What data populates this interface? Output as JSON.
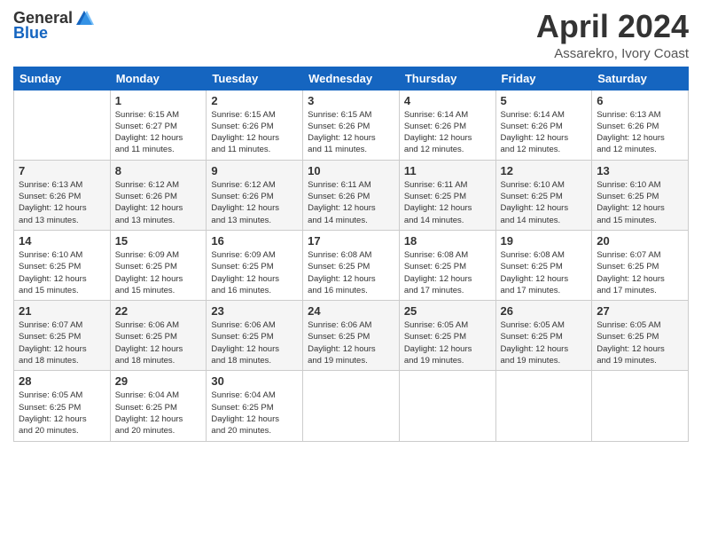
{
  "logo": {
    "text_general": "General",
    "text_blue": "Blue",
    "icon_shape": "triangle"
  },
  "header": {
    "month_title": "April 2024",
    "location": "Assarekro, Ivory Coast"
  },
  "days_of_week": [
    "Sunday",
    "Monday",
    "Tuesday",
    "Wednesday",
    "Thursday",
    "Friday",
    "Saturday"
  ],
  "weeks": [
    [
      {
        "day": "",
        "info": ""
      },
      {
        "day": "1",
        "info": "Sunrise: 6:15 AM\nSunset: 6:27 PM\nDaylight: 12 hours\nand 11 minutes."
      },
      {
        "day": "2",
        "info": "Sunrise: 6:15 AM\nSunset: 6:26 PM\nDaylight: 12 hours\nand 11 minutes."
      },
      {
        "day": "3",
        "info": "Sunrise: 6:15 AM\nSunset: 6:26 PM\nDaylight: 12 hours\nand 11 minutes."
      },
      {
        "day": "4",
        "info": "Sunrise: 6:14 AM\nSunset: 6:26 PM\nDaylight: 12 hours\nand 12 minutes."
      },
      {
        "day": "5",
        "info": "Sunrise: 6:14 AM\nSunset: 6:26 PM\nDaylight: 12 hours\nand 12 minutes."
      },
      {
        "day": "6",
        "info": "Sunrise: 6:13 AM\nSunset: 6:26 PM\nDaylight: 12 hours\nand 12 minutes."
      }
    ],
    [
      {
        "day": "7",
        "info": "Sunrise: 6:13 AM\nSunset: 6:26 PM\nDaylight: 12 hours\nand 13 minutes."
      },
      {
        "day": "8",
        "info": "Sunrise: 6:12 AM\nSunset: 6:26 PM\nDaylight: 12 hours\nand 13 minutes."
      },
      {
        "day": "9",
        "info": "Sunrise: 6:12 AM\nSunset: 6:26 PM\nDaylight: 12 hours\nand 13 minutes."
      },
      {
        "day": "10",
        "info": "Sunrise: 6:11 AM\nSunset: 6:26 PM\nDaylight: 12 hours\nand 14 minutes."
      },
      {
        "day": "11",
        "info": "Sunrise: 6:11 AM\nSunset: 6:25 PM\nDaylight: 12 hours\nand 14 minutes."
      },
      {
        "day": "12",
        "info": "Sunrise: 6:10 AM\nSunset: 6:25 PM\nDaylight: 12 hours\nand 14 minutes."
      },
      {
        "day": "13",
        "info": "Sunrise: 6:10 AM\nSunset: 6:25 PM\nDaylight: 12 hours\nand 15 minutes."
      }
    ],
    [
      {
        "day": "14",
        "info": "Sunrise: 6:10 AM\nSunset: 6:25 PM\nDaylight: 12 hours\nand 15 minutes."
      },
      {
        "day": "15",
        "info": "Sunrise: 6:09 AM\nSunset: 6:25 PM\nDaylight: 12 hours\nand 15 minutes."
      },
      {
        "day": "16",
        "info": "Sunrise: 6:09 AM\nSunset: 6:25 PM\nDaylight: 12 hours\nand 16 minutes."
      },
      {
        "day": "17",
        "info": "Sunrise: 6:08 AM\nSunset: 6:25 PM\nDaylight: 12 hours\nand 16 minutes."
      },
      {
        "day": "18",
        "info": "Sunrise: 6:08 AM\nSunset: 6:25 PM\nDaylight: 12 hours\nand 17 minutes."
      },
      {
        "day": "19",
        "info": "Sunrise: 6:08 AM\nSunset: 6:25 PM\nDaylight: 12 hours\nand 17 minutes."
      },
      {
        "day": "20",
        "info": "Sunrise: 6:07 AM\nSunset: 6:25 PM\nDaylight: 12 hours\nand 17 minutes."
      }
    ],
    [
      {
        "day": "21",
        "info": "Sunrise: 6:07 AM\nSunset: 6:25 PM\nDaylight: 12 hours\nand 18 minutes."
      },
      {
        "day": "22",
        "info": "Sunrise: 6:06 AM\nSunset: 6:25 PM\nDaylight: 12 hours\nand 18 minutes."
      },
      {
        "day": "23",
        "info": "Sunrise: 6:06 AM\nSunset: 6:25 PM\nDaylight: 12 hours\nand 18 minutes."
      },
      {
        "day": "24",
        "info": "Sunrise: 6:06 AM\nSunset: 6:25 PM\nDaylight: 12 hours\nand 19 minutes."
      },
      {
        "day": "25",
        "info": "Sunrise: 6:05 AM\nSunset: 6:25 PM\nDaylight: 12 hours\nand 19 minutes."
      },
      {
        "day": "26",
        "info": "Sunrise: 6:05 AM\nSunset: 6:25 PM\nDaylight: 12 hours\nand 19 minutes."
      },
      {
        "day": "27",
        "info": "Sunrise: 6:05 AM\nSunset: 6:25 PM\nDaylight: 12 hours\nand 19 minutes."
      }
    ],
    [
      {
        "day": "28",
        "info": "Sunrise: 6:05 AM\nSunset: 6:25 PM\nDaylight: 12 hours\nand 20 minutes."
      },
      {
        "day": "29",
        "info": "Sunrise: 6:04 AM\nSunset: 6:25 PM\nDaylight: 12 hours\nand 20 minutes."
      },
      {
        "day": "30",
        "info": "Sunrise: 6:04 AM\nSunset: 6:25 PM\nDaylight: 12 hours\nand 20 minutes."
      },
      {
        "day": "",
        "info": ""
      },
      {
        "day": "",
        "info": ""
      },
      {
        "day": "",
        "info": ""
      },
      {
        "day": "",
        "info": ""
      }
    ]
  ]
}
